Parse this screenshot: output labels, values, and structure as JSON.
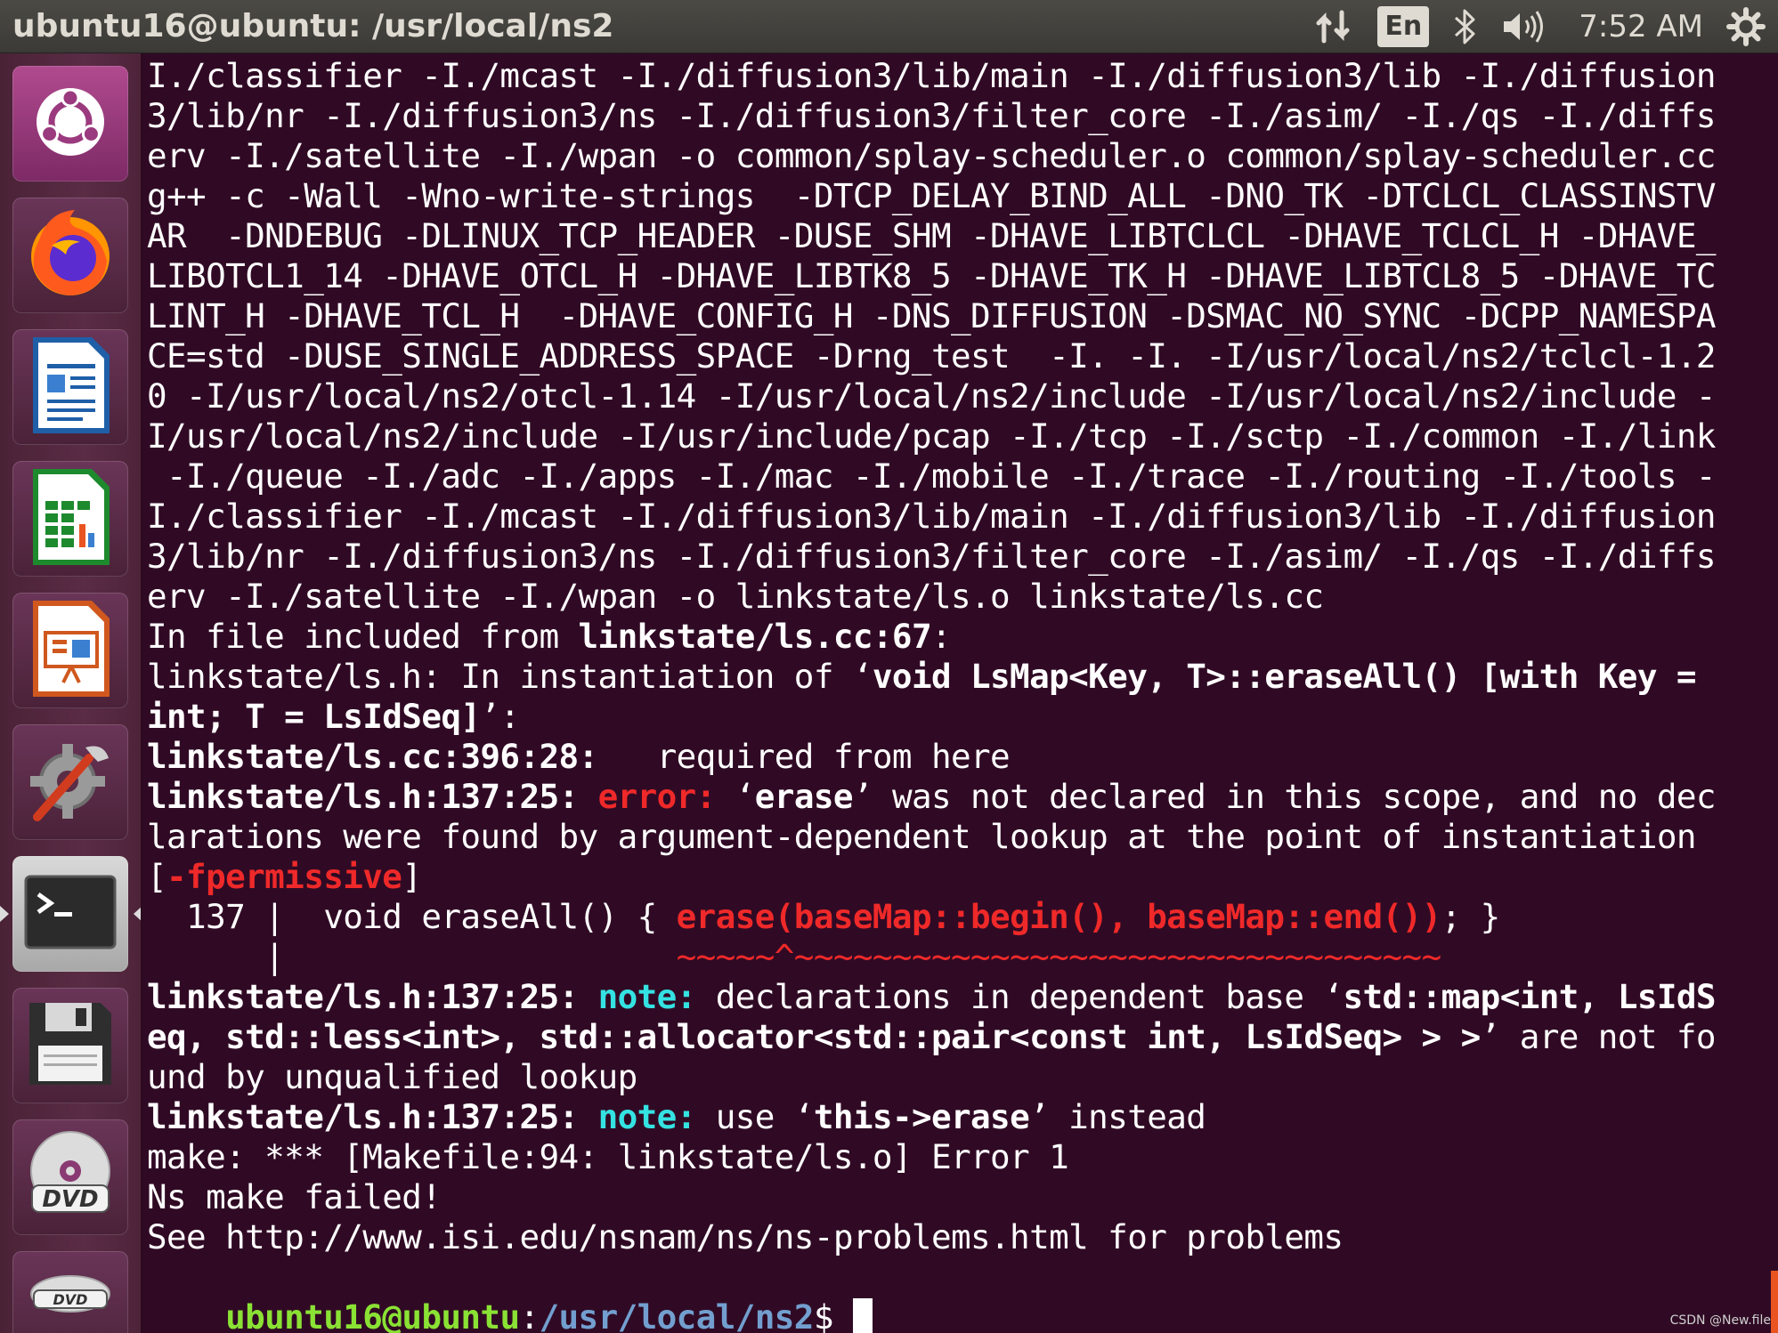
{
  "top_panel": {
    "window_title": "ubuntu16@ubuntu: /usr/local/ns2",
    "network_icon": "network-updown-icon",
    "keyboard_layout": "En",
    "bluetooth_icon": "bluetooth-icon",
    "volume_icon": "volume-icon",
    "time": "7:52 AM",
    "settings_icon": "gear-icon"
  },
  "launcher": {
    "items": [
      {
        "name": "ubuntu-dash",
        "icon": "ubuntu-logo-icon"
      },
      {
        "name": "firefox",
        "icon": "firefox-icon"
      },
      {
        "name": "libreoffice-writer",
        "icon": "writer-document-icon"
      },
      {
        "name": "libreoffice-calc",
        "icon": "calc-spreadsheet-icon"
      },
      {
        "name": "libreoffice-impress",
        "icon": "impress-presentation-icon"
      },
      {
        "name": "system-settings",
        "icon": "settings-wrench-icon"
      },
      {
        "name": "terminal",
        "icon": "terminal-icon"
      },
      {
        "name": "save",
        "icon": "floppy-disk-icon"
      },
      {
        "name": "dvd",
        "icon": "dvd-icon"
      },
      {
        "name": "dvd-2",
        "icon": "dvd-icon"
      }
    ],
    "active_item": "terminal"
  },
  "terminal": {
    "lines": [
      {
        "segments": [
          {
            "t": "I./classifier -I./mcast -I./diffusion3/lib/main -I./diffusion3/lib -I./diffusion"
          }
        ]
      },
      {
        "segments": [
          {
            "t": "3/lib/nr -I./diffusion3/ns -I./diffusion3/filter_core -I./asim/ -I./qs -I./diffs"
          }
        ]
      },
      {
        "segments": [
          {
            "t": "erv -I./satellite -I./wpan -o common/splay-scheduler.o common/splay-scheduler.cc"
          }
        ]
      },
      {
        "segments": [
          {
            "t": "g++ -c -Wall -Wno-write-strings  -DTCP_DELAY_BIND_ALL -DNO_TK -DTCLCL_CLASSINSTV"
          }
        ]
      },
      {
        "segments": [
          {
            "t": "AR  -DNDEBUG -DLINUX_TCP_HEADER -DUSE_SHM -DHAVE_LIBTCLCL -DHAVE_TCLCL_H -DHAVE_"
          }
        ]
      },
      {
        "segments": [
          {
            "t": "LIBOTCL1_14 -DHAVE_OTCL_H -DHAVE_LIBTK8_5 -DHAVE_TK_H -DHAVE_LIBTCL8_5 -DHAVE_TC"
          }
        ]
      },
      {
        "segments": [
          {
            "t": "LINT_H -DHAVE_TCL_H  -DHAVE_CONFIG_H -DNS_DIFFUSION -DSMAC_NO_SYNC -DCPP_NAMESPA"
          }
        ]
      },
      {
        "segments": [
          {
            "t": "CE=std -DUSE_SINGLE_ADDRESS_SPACE -Drng_test  -I. -I. -I/usr/local/ns2/tclcl-1.2"
          }
        ]
      },
      {
        "segments": [
          {
            "t": "0 -I/usr/local/ns2/otcl-1.14 -I/usr/local/ns2/include -I/usr/local/ns2/include -"
          }
        ]
      },
      {
        "segments": [
          {
            "t": "I/usr/local/ns2/include -I/usr/include/pcap -I./tcp -I./sctp -I./common -I./link"
          }
        ]
      },
      {
        "segments": [
          {
            "t": " -I./queue -I./adc -I./apps -I./mac -I./mobile -I./trace -I./routing -I./tools -"
          }
        ]
      },
      {
        "segments": [
          {
            "t": "I./classifier -I./mcast -I./diffusion3/lib/main -I./diffusion3/lib -I./diffusion"
          }
        ]
      },
      {
        "segments": [
          {
            "t": "3/lib/nr -I./diffusion3/ns -I./diffusion3/filter_core -I./asim/ -I./qs -I./diffs"
          }
        ]
      },
      {
        "segments": [
          {
            "t": "erv -I./satellite -I./wpan -o linkstate/ls.o linkstate/ls.cc"
          }
        ]
      },
      {
        "segments": [
          {
            "t": "In file included from "
          },
          {
            "t": "linkstate/ls.cc:67",
            "c": "b"
          },
          {
            "t": ":"
          }
        ]
      },
      {
        "segments": [
          {
            "t": "linkstate/ls.h: In instantiation of ‘"
          },
          {
            "t": "void LsMap<Key, T>::eraseAll() [with Key =",
            "c": "b"
          }
        ]
      },
      {
        "segments": [
          {
            "t": "int; T = LsIdSeq]",
            "c": "b"
          },
          {
            "t": "’:"
          }
        ]
      },
      {
        "segments": [
          {
            "t": "linkstate/ls.cc:396:28:",
            "c": "b"
          },
          {
            "t": "   required from here"
          }
        ]
      },
      {
        "segments": [
          {
            "t": "linkstate/ls.h:137:25: ",
            "c": "b"
          },
          {
            "t": "error: ",
            "c": "err"
          },
          {
            "t": "‘"
          },
          {
            "t": "erase",
            "c": "b"
          },
          {
            "t": "’ was not declared in this scope, and no dec"
          }
        ]
      },
      {
        "segments": [
          {
            "t": "larations were found by argument-dependent lookup at the point of instantiation"
          }
        ]
      },
      {
        "segments": [
          {
            "t": "["
          },
          {
            "t": "-fpermissive",
            "c": "err"
          },
          {
            "t": "]"
          }
        ]
      },
      {
        "segments": [
          {
            "t": "  137 |  void eraseAll() { "
          },
          {
            "t": "erase(baseMap::begin(), baseMap::end())",
            "c": "err"
          },
          {
            "t": "; }"
          }
        ]
      },
      {
        "segments": [
          {
            "t": "      |                    "
          },
          {
            "t": "~~~~~^~~~~~~~~~~~~~~~~~~~~~~~~~~~~~~~~~",
            "c": "red"
          }
        ]
      },
      {
        "segments": [
          {
            "t": "linkstate/ls.h:137:25: ",
            "c": "b"
          },
          {
            "t": "note: ",
            "c": "note"
          },
          {
            "t": "declarations in dependent base ‘"
          },
          {
            "t": "std::map<int, LsIdS",
            "c": "b"
          }
        ]
      },
      {
        "segments": [
          {
            "t": "eq, std::less<int>, std::allocator<std::pair<const int, LsIdSeq> > >",
            "c": "b"
          },
          {
            "t": "’ are not fo"
          }
        ]
      },
      {
        "segments": [
          {
            "t": "und by unqualified lookup"
          }
        ]
      },
      {
        "segments": [
          {
            "t": "linkstate/ls.h:137:25: ",
            "c": "b"
          },
          {
            "t": "note: ",
            "c": "note"
          },
          {
            "t": "use ‘"
          },
          {
            "t": "this->erase",
            "c": "b"
          },
          {
            "t": "’ instead"
          }
        ]
      },
      {
        "segments": [
          {
            "t": "make: *** [Makefile:94: linkstate/ls.o] Error 1"
          }
        ]
      },
      {
        "segments": [
          {
            "t": "Ns make failed!"
          }
        ]
      },
      {
        "segments": [
          {
            "t": "See http://www.isi.edu/nsnam/ns/ns-problems.html for problems"
          }
        ]
      }
    ],
    "prompt": {
      "user_host": "ubuntu16@ubuntu",
      "separator": ":",
      "path": "/usr/local/ns2",
      "symbol": "$ "
    }
  },
  "watermark": "CSDN @New.file",
  "colors": {
    "terminal_bg": "#300a24",
    "error": "#ef2929",
    "note": "#34e2e2",
    "prompt_user": "#8ae234",
    "prompt_path": "#729fcf",
    "ubuntu_orange": "#e95420"
  }
}
